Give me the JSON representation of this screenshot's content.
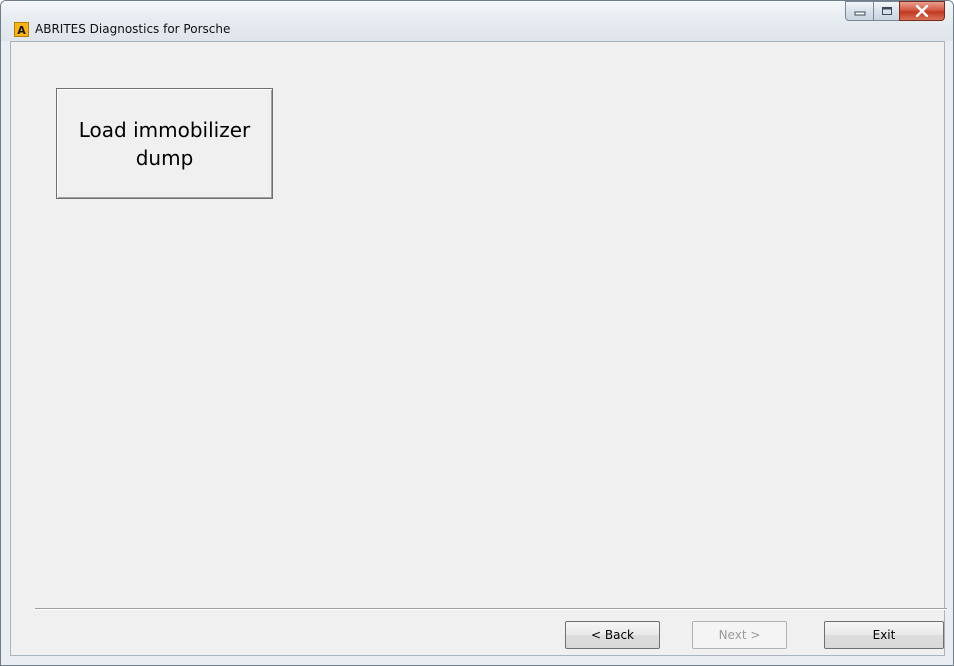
{
  "window": {
    "title": "ABRITES Diagnostics for Porsche",
    "app_icon_letter": "A"
  },
  "main": {
    "load_dump_label": "Load immobilizer dump"
  },
  "footer": {
    "back_label": "< Back",
    "next_label": "Next >",
    "exit_label": "Exit",
    "next_enabled": false
  },
  "icons": [
    "app-icon",
    "minimize-icon",
    "maximize-icon",
    "close-icon"
  ],
  "colors": {
    "client_background": "#f0f0f0",
    "close_button": "#c13a22",
    "app_icon": "#f6b31a"
  }
}
